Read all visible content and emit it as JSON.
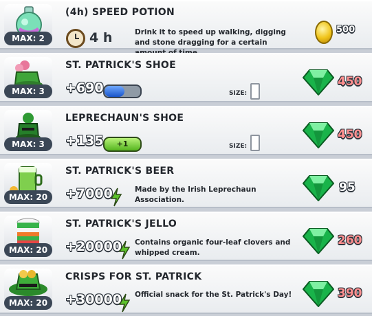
{
  "items": [
    {
      "name": "(4h) SPEED POTION",
      "max": "MAX: 2",
      "duration": "4 h",
      "description": "Drink it to speed up walking, digging and stone dragging for a certain amount of time.",
      "price": "500",
      "currency": "coin-icon",
      "icon": "speed-potion-icon"
    },
    {
      "name": "ST. PATRICK'S SHOE",
      "max": "MAX: 3",
      "value": "+690",
      "size_label": "SIZE:",
      "price": "450",
      "currency": "emerald-gem-icon",
      "icon": "st-patricks-shoe-icon",
      "bar_fill": 0.55
    },
    {
      "name": "LEPRECHAUN'S SHOE",
      "max": "MAX: 3",
      "value": "+135",
      "energy_badge": "+1",
      "size_label": "SIZE:",
      "price": "450",
      "currency": "emerald-gem-icon",
      "icon": "leprechauns-shoe-icon"
    },
    {
      "name": "ST. PATRICK'S BEER",
      "max": "MAX: 20",
      "value": "+7000",
      "description": "Made by the Irish Leprechaun Association.",
      "price": "95",
      "currency": "emerald-gem-icon",
      "icon": "st-patricks-beer-icon"
    },
    {
      "name": "ST. PATRICK'S JELLO",
      "max": "MAX: 20",
      "value": "+20000",
      "description": "Contains organic four-leaf clovers and whipped cream.",
      "price": "260",
      "currency": "emerald-gem-icon",
      "icon": "st-patricks-jello-icon"
    },
    {
      "name": "CRISPS FOR ST. PATRICK",
      "max": "MAX: 20",
      "value": "+30000",
      "description": "Official snack for the St. Patrick's Day!",
      "price": "390",
      "currency": "emerald-gem-icon",
      "icon": "crisps-icon"
    }
  ],
  "colors": {
    "price_red": "#ff8f8f",
    "gem_green": "#19b34a",
    "energy_green": "#5cc22a"
  }
}
